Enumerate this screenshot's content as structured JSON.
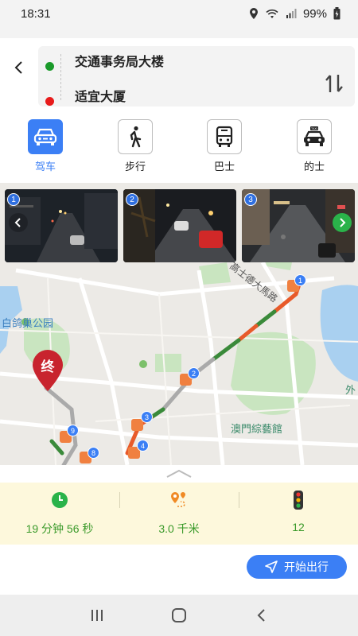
{
  "status_bar": {
    "time": "18:31",
    "battery": "99%"
  },
  "route": {
    "origin": "交通事务局大楼",
    "destination": "适宜大厦"
  },
  "modes": [
    {
      "label": "驾车",
      "icon": "car-icon",
      "active": true
    },
    {
      "label": "步行",
      "icon": "walk-icon",
      "active": false
    },
    {
      "label": "巴士",
      "icon": "bus-icon",
      "active": false
    },
    {
      "label": "的士",
      "icon": "taxi-icon",
      "active": false
    }
  ],
  "cameras": [
    {
      "number": "1"
    },
    {
      "number": "2"
    },
    {
      "number": "3"
    }
  ],
  "map": {
    "labels": {
      "park": "白鸽巢公园",
      "road": "高士德大馬路",
      "venue": "澳門綜藝館",
      "edge": "外"
    },
    "end_marker": "终",
    "route_markers": [
      "1",
      "2",
      "3",
      "4",
      "8",
      "9"
    ]
  },
  "stats": {
    "duration": "19 分钟 56 秒",
    "distance": "3.0 千米",
    "traffic_lights": "12"
  },
  "actions": {
    "start_label": "开始出行"
  },
  "colors": {
    "accent": "#3b7ff5",
    "start_dot": "#1a9a2a",
    "end_dot": "#e81b1b",
    "stat_text": "#3a9a2a"
  }
}
